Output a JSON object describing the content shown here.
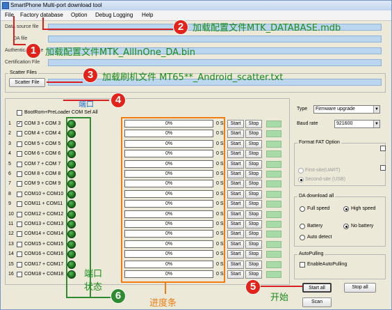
{
  "window": {
    "title": "SmartPhone Multi-port download tool"
  },
  "menu": [
    "File",
    "Factory database",
    "Option",
    "Debug Logging",
    "Help"
  ],
  "paths": {
    "data_source": "Data source file",
    "da_file": "DA file",
    "authentication": "Authentication file",
    "certification": "Certification File"
  },
  "scatter": {
    "group": "Scatter Files",
    "button": "Scatter File"
  },
  "ports_header": {
    "select_all": "BootRom+PreLoader COM Sel All"
  },
  "rows": [
    {
      "n": "1",
      "port": "COM 3 + COM 3",
      "checked": "✓",
      "progress": "0%",
      "secs": "0 S"
    },
    {
      "n": "2",
      "port": "COM 4 + COM 4",
      "checked": "",
      "progress": "0%",
      "secs": "0 S"
    },
    {
      "n": "3",
      "port": "COM 5 + COM 5",
      "checked": "",
      "progress": "0%",
      "secs": "0 S"
    },
    {
      "n": "4",
      "port": "COM 6 + COM 6",
      "checked": "",
      "progress": "0%",
      "secs": "0 S"
    },
    {
      "n": "5",
      "port": "COM 7 + COM 7",
      "checked": "",
      "progress": "0%",
      "secs": "0 S"
    },
    {
      "n": "6",
      "port": "COM 8 + COM 8",
      "checked": "",
      "progress": "0%",
      "secs": "0 S"
    },
    {
      "n": "7",
      "port": "COM 9 + COM 9",
      "checked": "",
      "progress": "0%",
      "secs": "0 S"
    },
    {
      "n": "8",
      "port": "COM10 + COM10",
      "checked": "",
      "progress": "0%",
      "secs": "0 S"
    },
    {
      "n": "9",
      "port": "COM11 + COM11",
      "checked": "",
      "progress": "0%",
      "secs": "0 S"
    },
    {
      "n": "10",
      "port": "COM12 + COM12",
      "checked": "",
      "progress": "0%",
      "secs": "0 S"
    },
    {
      "n": "11",
      "port": "COM13 + COM13",
      "checked": "",
      "progress": "0%",
      "secs": "0 S"
    },
    {
      "n": "12",
      "port": "COM14 + COM14",
      "checked": "",
      "progress": "0%",
      "secs": "0 S"
    },
    {
      "n": "13",
      "port": "COM15 + COM15",
      "checked": "",
      "progress": "0%",
      "secs": "0 S"
    },
    {
      "n": "14",
      "port": "COM16 + COM16",
      "checked": "",
      "progress": "0%",
      "secs": "0 S"
    },
    {
      "n": "15",
      "port": "COM17 + COM17",
      "checked": "",
      "progress": "0%",
      "secs": "0 S"
    },
    {
      "n": "16",
      "port": "COM18 + COM18",
      "checked": "",
      "progress": "0%",
      "secs": "0 S"
    }
  ],
  "row_buttons": {
    "start": "Start",
    "stop": "Stop"
  },
  "settings": {
    "type_label": "Type",
    "type_value": "Firmware upgrade",
    "baud_label": "Baud rate",
    "baud_value": "921600",
    "fat_group": "Format FAT Option",
    "fat_opt1": "First-site(UART)",
    "fat_opt2": "Second-site (USB)",
    "da_group": "DA download all",
    "full_speed": "Full speed",
    "high_speed": "High speed",
    "battery": "Battery",
    "no_battery": "No battery",
    "auto_detect": "Auto detect",
    "autopulling_group": "AutoPulling",
    "enable_autopulling": "EnableAutoPulling"
  },
  "bottom_buttons": {
    "start_all": "Start all",
    "stop_all": "Stop all",
    "scan": "Scan"
  },
  "annotations": {
    "n1": "1",
    "t1": "加载配置文件MTK_AllInOne_DA.bin",
    "n2": "2",
    "t2": "加载配置文件MTK_DATABASE.mdb",
    "n3": "3",
    "t3": "加载刷机文件 MT65**_Android_scatter.txt",
    "n4": "4",
    "t4": "端口",
    "n5": "5",
    "t5": "开始",
    "n6": "6",
    "t6a": "端口",
    "t6b": "状态",
    "t7": "进度条"
  },
  "colors": {
    "annotation_red": "#e2231a",
    "annotation_green": "#2f8b2f",
    "path_field": "#bcd6f0",
    "led_green": "#136313"
  }
}
